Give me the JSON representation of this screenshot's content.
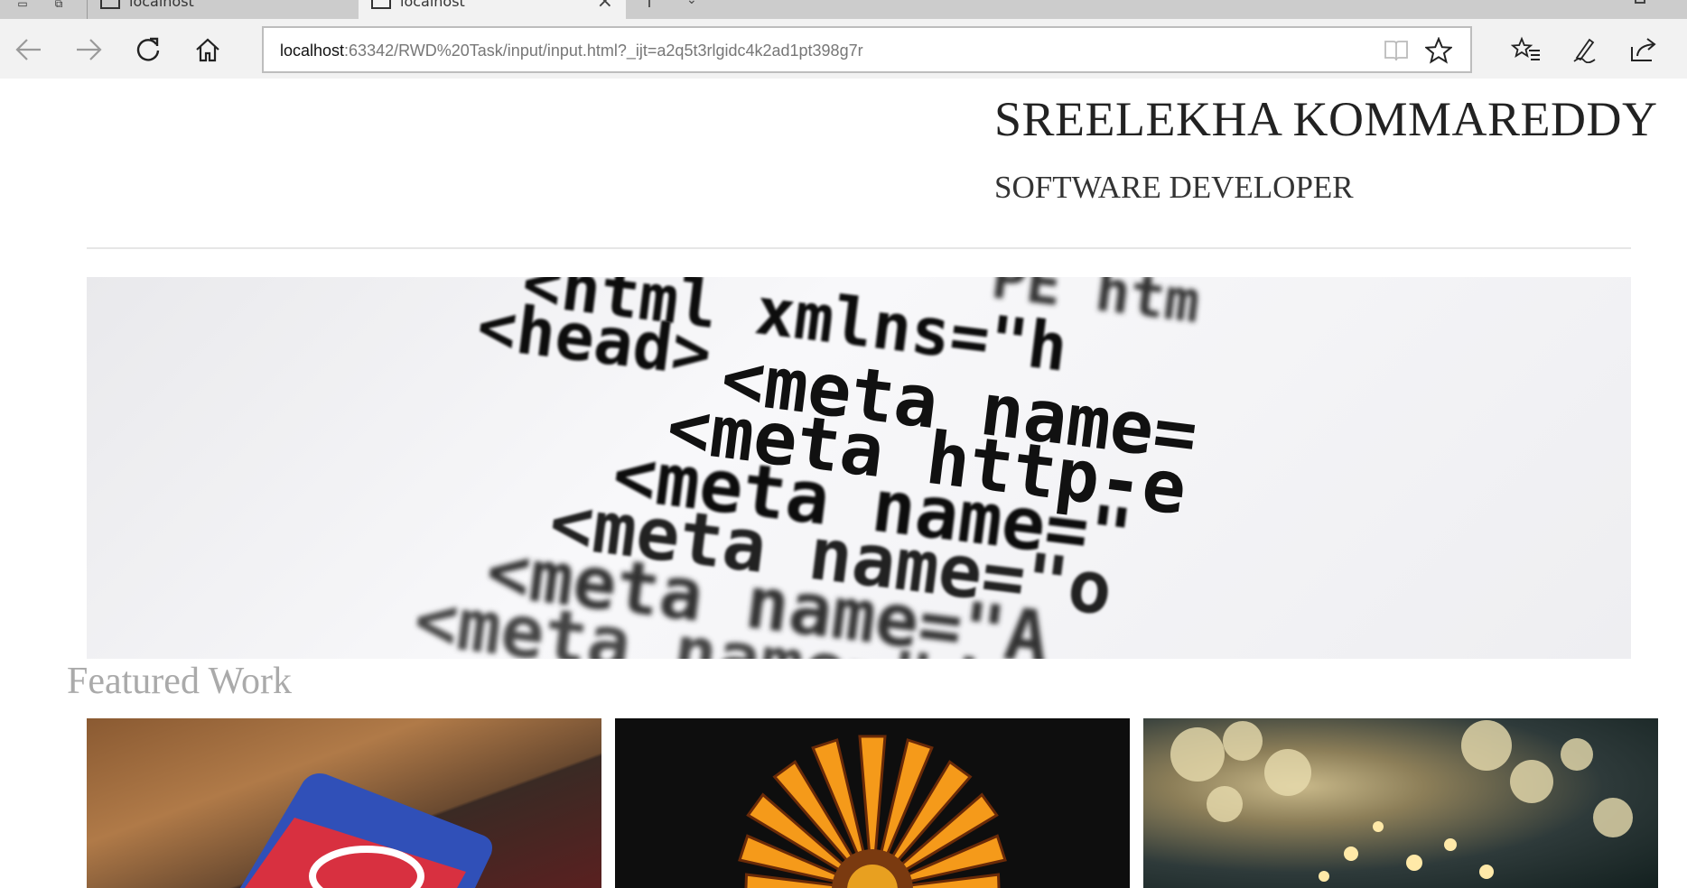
{
  "browser": {
    "tabs": [
      {
        "label": "localhost",
        "active": false
      },
      {
        "label": "localhost",
        "active": true
      }
    ],
    "address": {
      "host": "localhost",
      "path": ":63342/RWD%20Task/input/input.html?_ijt=a2q5t3rlgidc4k2ad1pt398g7r"
    },
    "icons": [
      "back-arrow-icon",
      "forward-arrow-icon",
      "refresh-icon",
      "home-icon",
      "reading-view-icon",
      "favorite-star-icon",
      "favorites-hub-icon",
      "pen-note-icon",
      "share-icon"
    ]
  },
  "header": {
    "name": "SREELEKHA KOMMAREDDY",
    "role": "SOFTWARE DEVELOPER"
  },
  "hero": {
    "code_lines": [
      "<html   xmlns=\"h",
      "<head>",
      "<meta  name=",
      "<meta  http-e",
      "<meta  name=\"",
      "<meta  name=\"o",
      "<meta  name=\"A",
      "<meta  name=\"d"
    ],
    "top_fragment": "PE  htm"
  },
  "featured": {
    "title": "Featured Work",
    "items": [
      {
        "id": "work-1"
      },
      {
        "id": "work-2"
      },
      {
        "id": "work-3"
      }
    ]
  },
  "colors": {
    "tabstrip": "#cccccc",
    "toolbar": "#f2f2f2",
    "heading_text": "#222222",
    "featured_text": "#aaaaaa"
  }
}
